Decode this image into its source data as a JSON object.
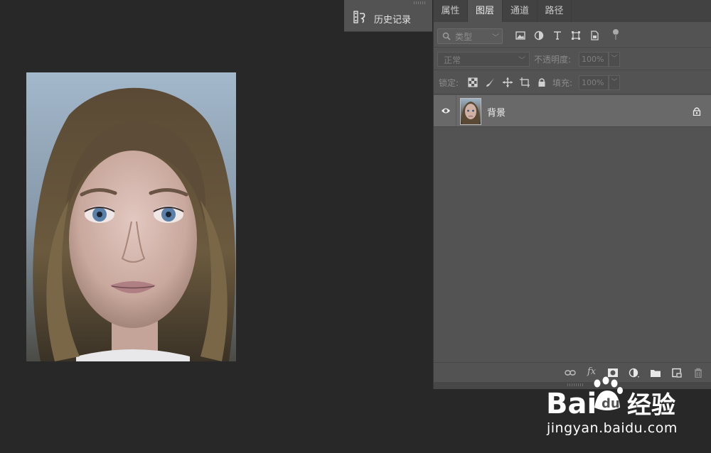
{
  "history": {
    "label": "历史记录"
  },
  "tabs": [
    {
      "label": "属性"
    },
    {
      "label": "图层"
    },
    {
      "label": "通道"
    },
    {
      "label": "路径"
    }
  ],
  "filter": {
    "label": "类型"
  },
  "blend": {
    "mode": "正常",
    "opacity_label": "不透明度:",
    "opacity_value": "100%"
  },
  "lock": {
    "label": "锁定:",
    "fill_label": "填充:",
    "fill_value": "100%"
  },
  "layers": [
    {
      "name": "背景"
    }
  ],
  "watermark": {
    "url": "jingyan.baidu.com"
  },
  "colors": {
    "panel": "#535353",
    "tabbar": "#424242",
    "canvas": "#282828",
    "selected_layer": "#696969"
  }
}
